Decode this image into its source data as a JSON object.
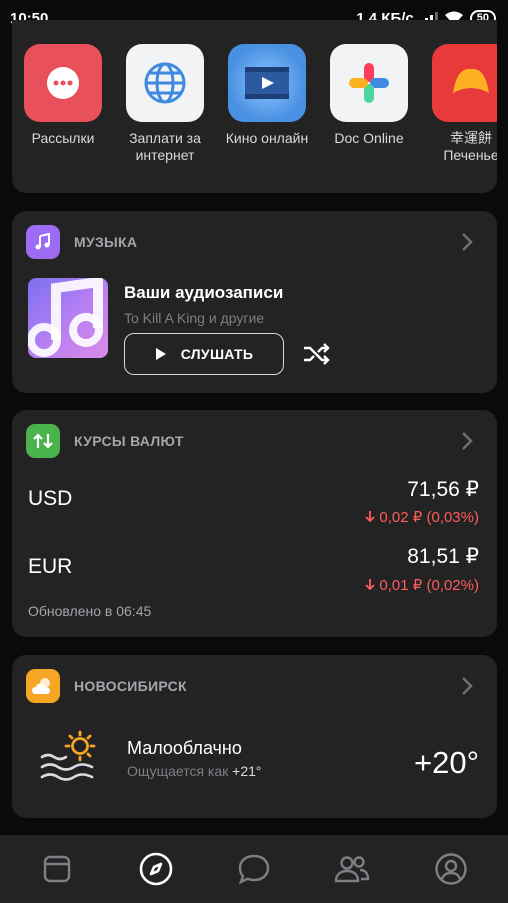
{
  "statusbar": {
    "time": "10:50",
    "network_speed": "1,4 КБ/с",
    "battery": "50"
  },
  "apps": [
    {
      "label": "Рассылки",
      "icon": "chat-bubble-icon",
      "color": "#e8505b"
    },
    {
      "label": "Заплати за\nинтернет",
      "icon": "globe-icon",
      "color": "#f2f3f5"
    },
    {
      "label": "Кино онлайн",
      "icon": "film-icon",
      "color": "#4a90e2"
    },
    {
      "label": "Doc Online",
      "icon": "plus-cross-icon",
      "color": "#f2f3f5"
    },
    {
      "label": "幸運餅\nПеченье",
      "icon": "fortune-cookie-icon",
      "color": "#e83a3a"
    }
  ],
  "music": {
    "section_title": "МУЗЫКА",
    "title": "Ваши аудиозаписи",
    "subtitle": "To Kill A King и другие",
    "listen_label": "СЛУШАТЬ",
    "accent": "#9c6cf5"
  },
  "rates": {
    "section_title": "КУРСЫ ВАЛЮТ",
    "accent": "#4bb34b",
    "items": [
      {
        "code": "USD",
        "value": "71,56 ₽",
        "delta": "0,02 ₽ (0,03%)"
      },
      {
        "code": "EUR",
        "value": "81,51 ₽",
        "delta": "0,01 ₽ (0,02%)"
      }
    ],
    "updated": "Обновлено в 06:45",
    "down_color": "#ff5c5c"
  },
  "weather": {
    "section_title": "НОВОСИБИРСК",
    "accent": "#f5a623",
    "condition": "Малооблачно",
    "feels_prefix": "Ощущается как ",
    "feels_value": "+21°",
    "temp": "+20°"
  },
  "tabbar": {
    "active": "explore",
    "icons": [
      "newsfeed-icon",
      "compass-icon",
      "messages-icon",
      "friends-icon",
      "profile-icon"
    ]
  }
}
